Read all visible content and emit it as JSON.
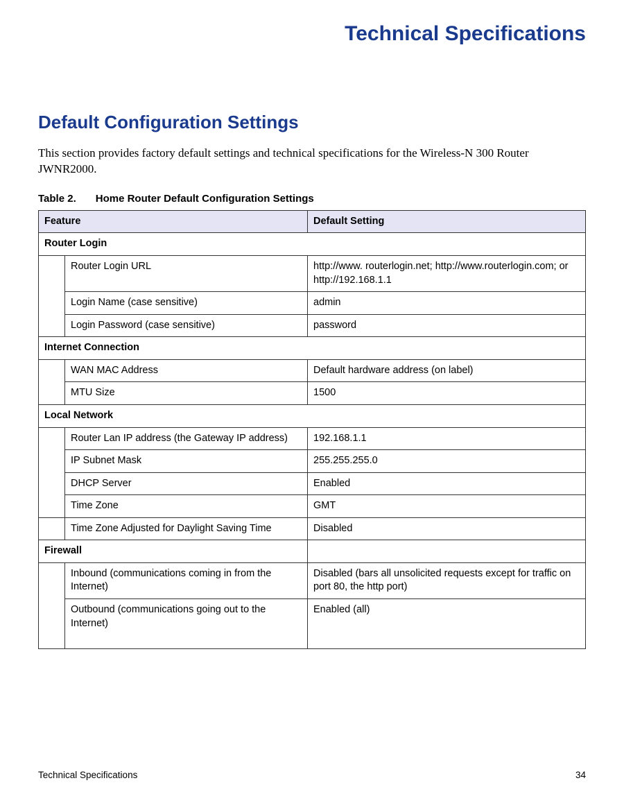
{
  "page_title": "Technical Specifications",
  "section_title": "Default Configuration Settings",
  "intro_text": "This section provides factory default settings and technical specifications for the Wireless-N 300 Router JWNR2000.",
  "table_caption_prefix": "Table 2.",
  "table_caption": "Home Router Default Configuration Settings",
  "headers": {
    "feature": "Feature",
    "default": "Default Setting"
  },
  "sections": [
    {
      "name": "Router Login",
      "rows": [
        {
          "feature": "Router Login URL",
          "value": "http://www. routerlogin.net; http://www.routerlogin.com; or http://192.168.1.1"
        },
        {
          "feature": "Login Name (case sensitive)",
          "value": "admin"
        },
        {
          "feature": "Login Password (case sensitive)",
          "value": "password"
        }
      ]
    },
    {
      "name": "Internet Connection",
      "rows": [
        {
          "feature": "WAN MAC Address",
          "value": "Default hardware address (on label)"
        },
        {
          "feature": "MTU Size",
          "value": "1500"
        }
      ]
    },
    {
      "name": "Local Network",
      "rows": [
        {
          "feature": "Router Lan IP address (the Gateway IP address)",
          "value": "192.168.1.1"
        },
        {
          "feature": "IP Subnet Mask",
          "value": "255.255.255.0"
        },
        {
          "feature": "DHCP Server",
          "value": "Enabled"
        },
        {
          "feature": "Time Zone",
          "value": "GMT"
        },
        {
          "feature": "Time Zone Adjusted for Daylight Saving Time",
          "value": "Disabled"
        }
      ]
    },
    {
      "name": "Firewall",
      "rows": [
        {
          "feature": "Inbound (communications coming in from the Internet)",
          "value": "Disabled (bars all unsolicited requests except for traffic on port 80, the http port)"
        },
        {
          "feature": "Outbound (communications going out to the Internet)",
          "value": "Enabled (all)"
        }
      ]
    }
  ],
  "footer": {
    "left": "Technical Specifications",
    "right": "34"
  }
}
